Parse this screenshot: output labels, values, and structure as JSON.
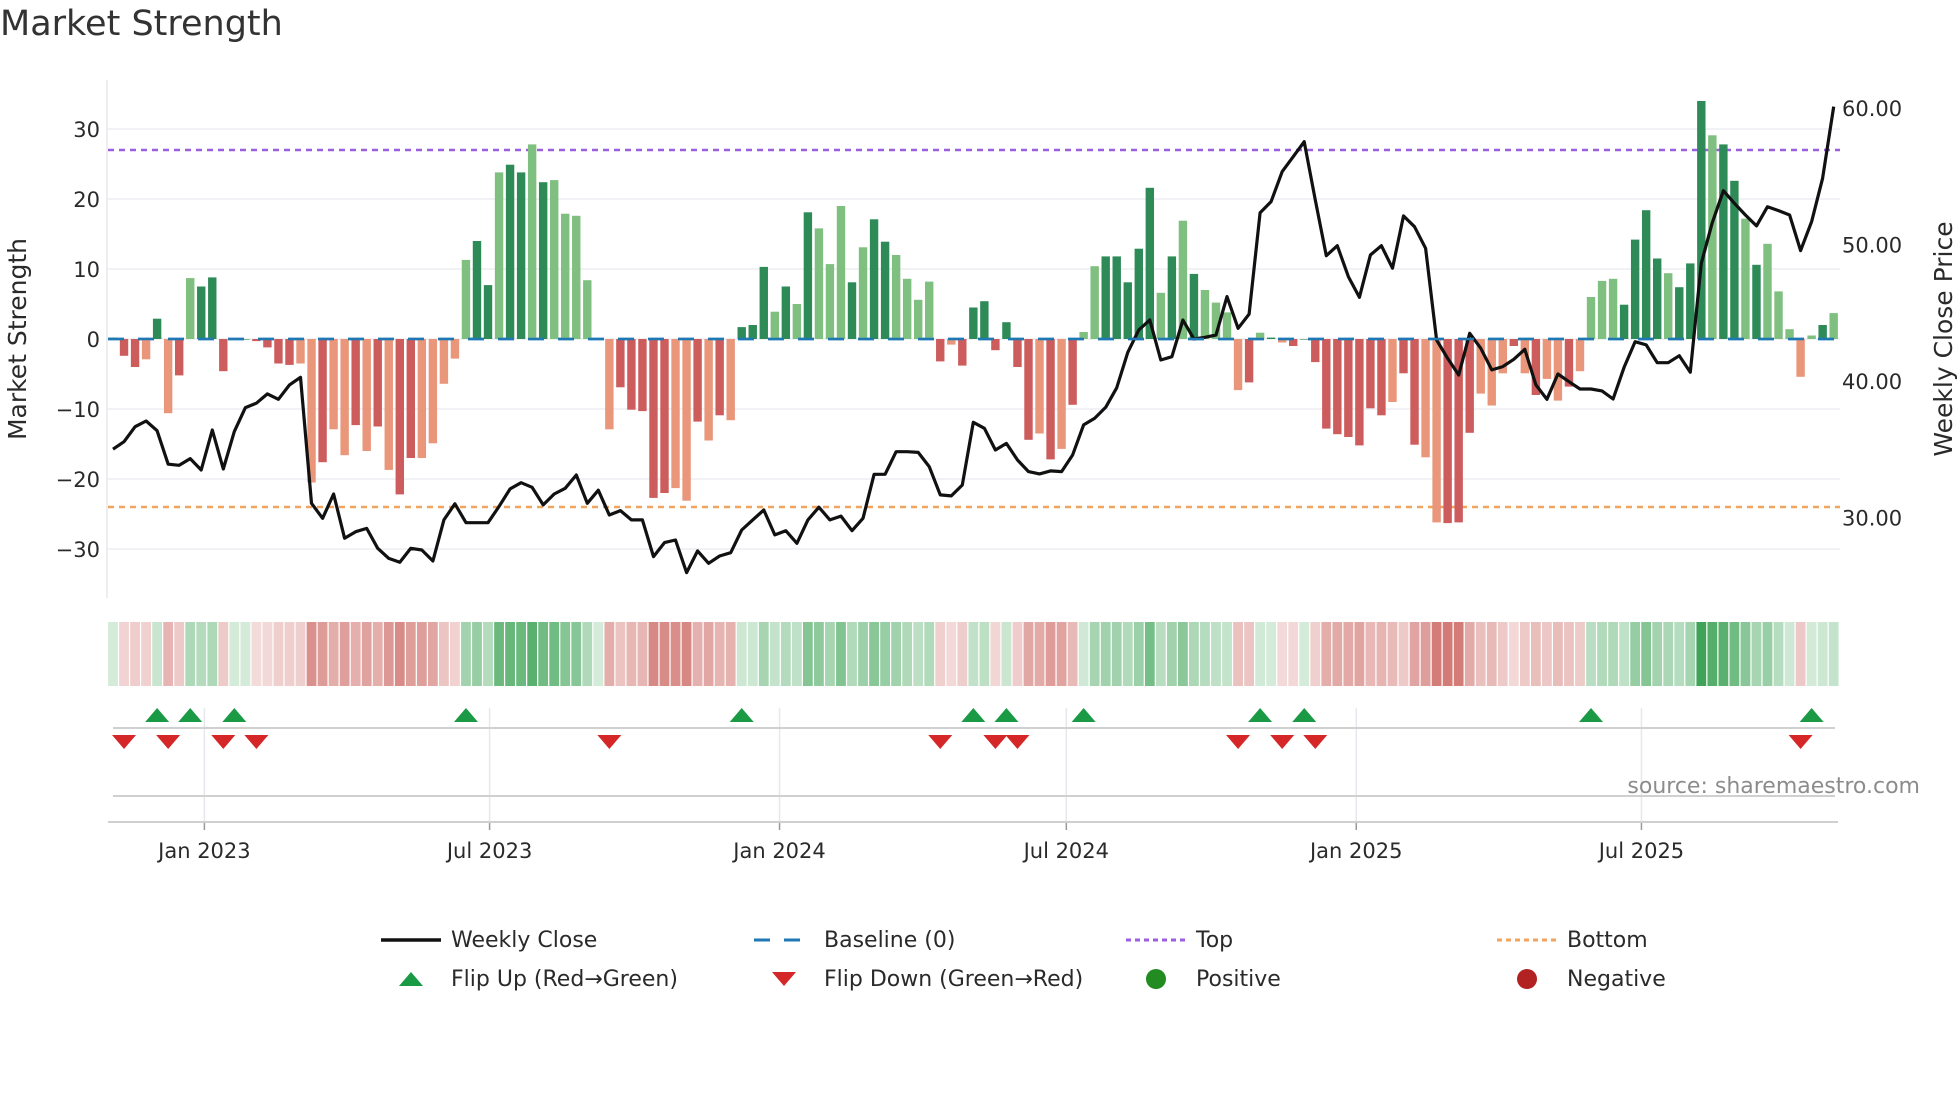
{
  "chart_data": {
    "type": "bar",
    "title": "Market Strength",
    "ylabel": "Market Strength",
    "y2label": "Weekly Close Price",
    "ylim": [
      -37,
      37
    ],
    "y2lim": [
      24.1,
      62.05
    ],
    "yticks": [
      30,
      20,
      10,
      0,
      -10,
      -20,
      -30
    ],
    "ytick_labels": [
      "30",
      "20",
      "10",
      "0",
      "−10",
      "−20",
      "−30"
    ],
    "y2ticks": [
      60,
      50,
      40,
      30
    ],
    "y2tick_labels": [
      "60.00",
      "50.00",
      "40.00",
      "30.00"
    ],
    "xtick_dates": [
      "2023-01-01",
      "2023-07-01",
      "2024-01-01",
      "2024-07-01",
      "2025-01-01",
      "2025-07-01"
    ],
    "xtick_labels": [
      "Jan 2023",
      "Jul 2023",
      "Jan 2024",
      "Jul 2024",
      "Jan 2025",
      "Jul 2025"
    ],
    "start_date": "2022-11-04",
    "frequency": "weekly",
    "grid": true,
    "top_level": 27,
    "bottom_level": -24,
    "baseline": 0,
    "strength": [
      0.2,
      -2.4,
      -4.0,
      -2.9,
      2.9,
      -10.6,
      -5.2,
      8.7,
      7.5,
      8.8,
      -4.6,
      0,
      0,
      -0.3,
      -1.2,
      -3.5,
      -3.7,
      -3.5,
      -20.5,
      -17.6,
      -12.9,
      -16.6,
      -12.3,
      -16.0,
      -12.5,
      -18.7,
      -22.2,
      -17.0,
      -17.0,
      -14.9,
      -6.4,
      -2.8,
      11.3,
      14.0,
      7.7,
      23.8,
      24.9,
      23.8,
      27.8,
      22.4,
      22.7,
      17.9,
      17.6,
      8.4,
      0.1,
      -12.9,
      -6.9,
      -10.1,
      -10.3,
      -22.7,
      -22.0,
      -21.3,
      -23.1,
      -11.8,
      -14.5,
      -10.9,
      -11.6,
      1.7,
      2.0,
      10.3,
      3.9,
      7.5,
      5.0,
      18.1,
      15.8,
      10.7,
      19.0,
      8.1,
      13.1,
      17.1,
      13.9,
      12.0,
      8.6,
      5.6,
      8.2,
      -3.2,
      -0.8,
      -3.8,
      4.5,
      5.4,
      -1.6,
      2.4,
      -4.0,
      -14.4,
      -13.5,
      -17.2,
      -15.7,
      -9.4,
      1.0,
      10.4,
      11.8,
      11.8,
      8.1,
      12.9,
      21.6,
      6.6,
      11.8,
      16.9,
      9.3,
      7.0,
      5.2,
      3.8,
      -7.3,
      -6.2,
      0.9,
      0.2,
      -0.5,
      -1.0,
      0,
      -3.3,
      -12.8,
      -13.6,
      -14.0,
      -15.2,
      -9.9,
      -10.9,
      -9.0,
      -4.9,
      -15.1,
      -16.9,
      -26.2,
      -26.3,
      -26.2,
      -13.4,
      -7.8,
      -9.5,
      -4.9,
      -1.0,
      -4.9,
      -8.0,
      -5.7,
      -8.8,
      -6.8,
      -4.6,
      6.0,
      8.3,
      8.6,
      4.9,
      14.2,
      18.4,
      11.5,
      9.4,
      7.4,
      10.8,
      34.0,
      29.1,
      27.8,
      22.6,
      17.2,
      10.6,
      13.6,
      6.8,
      1.4,
      -5.4,
      0.5,
      2.0,
      3.7
    ],
    "shade": "dddldldldddddddddlldlldldlddlllllddlddldlllldldddddlldldldddldldllldlddlllldldddddddldldlldddddldldlllldldldddddddddlddlldddllldldlldllllddddldddlddldllllldldlddd",
    "close": [
      35.0,
      35.55,
      36.65,
      37.07,
      36.36,
      33.9,
      33.82,
      34.31,
      33.48,
      36.41,
      33.55,
      36.29,
      38.05,
      38.37,
      39.05,
      38.66,
      39.71,
      40.27,
      31.04,
      29.94,
      31.72,
      28.48,
      28.96,
      29.2,
      27.74,
      27.0,
      26.72,
      27.74,
      27.62,
      26.81,
      29.82,
      31.0,
      29.62,
      29.62,
      29.62,
      30.8,
      32.09,
      32.55,
      32.21,
      30.92,
      31.72,
      32.14,
      33.11,
      31.04,
      32.0,
      30.18,
      30.5,
      29.82,
      29.82,
      27.13,
      28.16,
      28.35,
      25.96,
      27.55,
      26.64,
      27.18,
      27.42,
      29.08,
      29.82,
      30.55,
      28.72,
      29.03,
      28.11,
      29.82,
      30.75,
      29.82,
      30.1,
      29.03,
      29.94,
      33.16,
      33.16,
      34.82,
      34.82,
      34.77,
      33.73,
      31.65,
      31.58,
      32.38,
      36.97,
      36.53,
      34.94,
      35.43,
      34.21,
      33.36,
      33.19,
      33.41,
      33.36,
      34.58,
      36.78,
      37.27,
      38.07,
      39.5,
      42.1,
      43.74,
      44.47,
      41.54,
      41.78,
      44.47,
      43.08,
      43.2,
      43.37,
      46.18,
      43.86,
      44.9,
      52.33,
      53.14,
      55.34,
      56.43,
      57.53,
      53.26,
      49.18,
      49.91,
      47.64,
      46.13,
      49.23,
      49.91,
      48.26,
      52.09,
      51.3,
      49.72,
      43.0,
      41.66,
      40.44,
      43.49,
      42.4,
      40.81,
      41.05,
      41.59,
      42.32,
      39.71,
      38.66,
      40.51,
      39.95,
      39.41,
      39.41,
      39.27,
      38.68,
      41.0,
      42.88,
      42.64,
      41.34,
      41.34,
      41.85,
      40.64,
      48.62,
      51.6,
      53.94,
      53.02,
      52.16,
      51.36,
      52.77,
      52.48,
      52.16,
      49.55,
      51.67,
      54.85,
      60.1
    ],
    "flip_up_weeks": [
      4,
      7,
      11,
      32,
      57,
      78,
      81,
      88,
      104,
      108,
      134,
      154
    ],
    "flip_down_weeks": [
      1,
      5,
      10,
      13,
      45,
      75,
      80,
      82,
      102,
      106,
      109,
      153
    ],
    "legend_position": "bottom",
    "legend": [
      {
        "label": "Weekly Close",
        "kind": "line"
      },
      {
        "label": "Baseline (0)",
        "kind": "dash"
      },
      {
        "label": "Top",
        "kind": "dot-top"
      },
      {
        "label": "Bottom",
        "kind": "dot-bottom"
      },
      {
        "label": "Flip Up (Red→Green)",
        "kind": "tri-up"
      },
      {
        "label": "Flip Down (Green→Red)",
        "kind": "tri-down"
      },
      {
        "label": "Positive",
        "kind": "dot-pos"
      },
      {
        "label": "Negative",
        "kind": "dot-neg"
      }
    ],
    "source": "source: sharemaestro.com"
  },
  "colors": {
    "green_dark": "#2e8b57",
    "green_light": "#7fbf7f",
    "red_dark": "#cd5c5c",
    "red_light": "#e9967a",
    "heat_green": "#3fa457",
    "heat_red": "#c9605a",
    "line": "#111111",
    "baseline": "#1f77b4",
    "top": "#9b5fe0",
    "bottom": "#f0a45e",
    "flip_up": "#1a9a45",
    "flip_down": "#d62728",
    "positive": "#228b22",
    "negative": "#b22222",
    "grid": "#eceef3"
  }
}
